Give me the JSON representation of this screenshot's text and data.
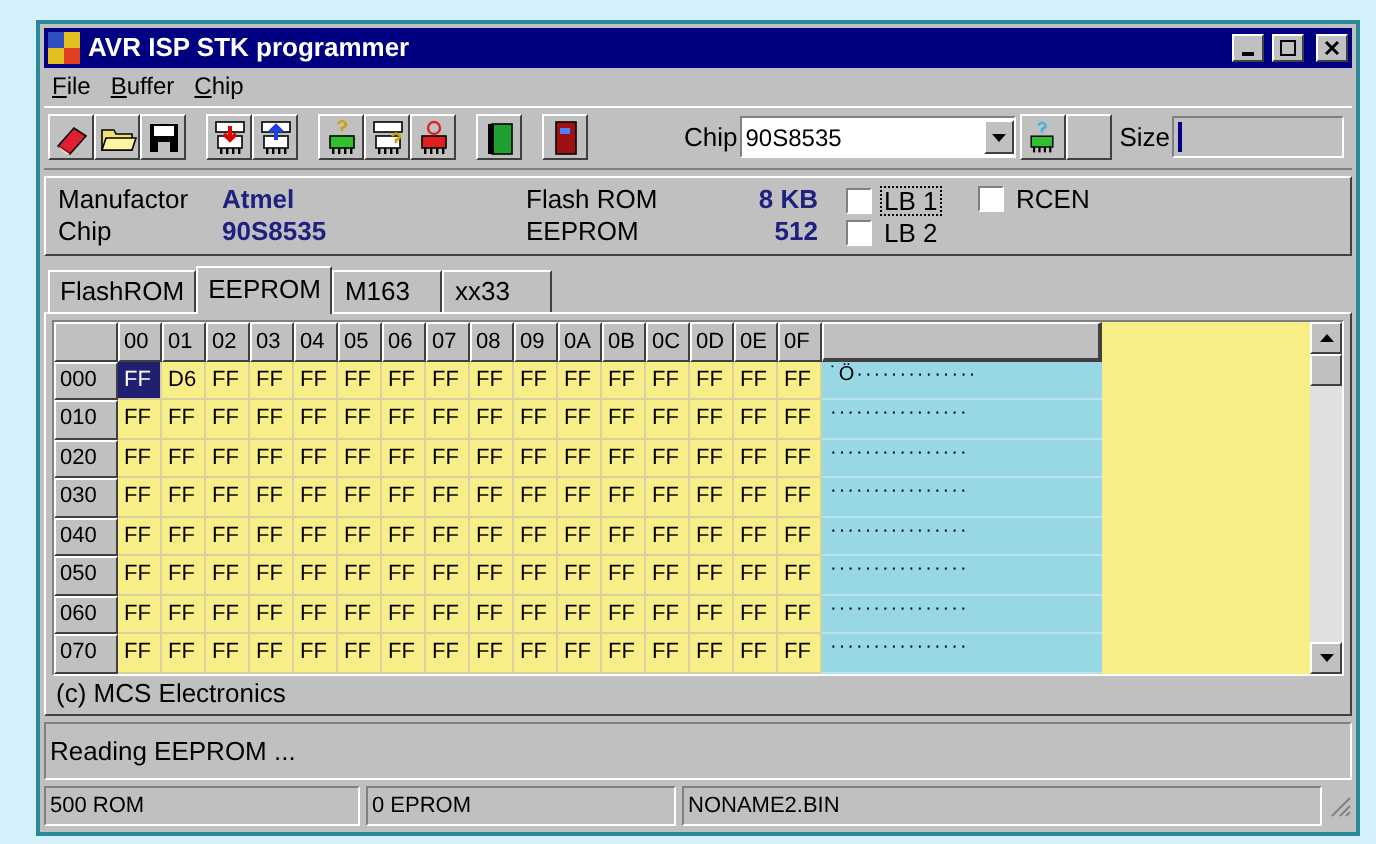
{
  "window": {
    "title": "AVR ISP STK programmer"
  },
  "menu": [
    {
      "label": "File"
    },
    {
      "label": "Buffer"
    },
    {
      "label": "Chip"
    }
  ],
  "chip_select": {
    "label": "Chip",
    "value": "90S8535"
  },
  "size": {
    "label": "Size",
    "level": 0.03
  },
  "info": {
    "manufacturer_label": "Manufactor",
    "manufacturer": "Atmel",
    "chip_label": "Chip",
    "chip": "90S8535",
    "flash_label": "Flash ROM",
    "flash": "8 KB",
    "eeprom_label": "EEPROM",
    "eeprom": "512"
  },
  "lock_bits": [
    {
      "label": "LB 1",
      "checked": false,
      "focused": true
    },
    {
      "label": "LB 2",
      "checked": false,
      "focused": false
    }
  ],
  "options": [
    {
      "label": "RCEN",
      "checked": false
    }
  ],
  "tabs": [
    {
      "label": "FlashROM",
      "selected": false
    },
    {
      "label": "EEPROM",
      "selected": true
    },
    {
      "label": "M163",
      "selected": false
    },
    {
      "label": "xx33",
      "selected": false
    }
  ],
  "grid": {
    "columns": [
      "00",
      "01",
      "02",
      "03",
      "04",
      "05",
      "06",
      "07",
      "08",
      "09",
      "0A",
      "0B",
      "0C",
      "0D",
      "0E",
      "0F"
    ],
    "rows": [
      {
        "address": "000",
        "cells": [
          {
            "text": "FF",
            "selected": true
          },
          {
            "text": "D6",
            "selected": false
          },
          {
            "text": "FF",
            "selected": false
          },
          {
            "text": "FF",
            "selected": false
          },
          {
            "text": "FF",
            "selected": false
          },
          {
            "text": "FF",
            "selected": false
          },
          {
            "text": "FF",
            "selected": false
          },
          {
            "text": "FF",
            "selected": false
          },
          {
            "text": "FF",
            "selected": false
          },
          {
            "text": "FF",
            "selected": false
          },
          {
            "text": "FF",
            "selected": false
          },
          {
            "text": "FF",
            "selected": false
          },
          {
            "text": "FF",
            "selected": false
          },
          {
            "text": "FF",
            "selected": false
          },
          {
            "text": "FF",
            "selected": false
          },
          {
            "text": "FF",
            "selected": false
          }
        ],
        "ascii": "˙Ö··············"
      },
      {
        "address": "010",
        "cells": [
          {
            "text": "FF",
            "selected": false
          },
          {
            "text": "FF",
            "selected": false
          },
          {
            "text": "FF",
            "selected": false
          },
          {
            "text": "FF",
            "selected": false
          },
          {
            "text": "FF",
            "selected": false
          },
          {
            "text": "FF",
            "selected": false
          },
          {
            "text": "FF",
            "selected": false
          },
          {
            "text": "FF",
            "selected": false
          },
          {
            "text": "FF",
            "selected": false
          },
          {
            "text": "FF",
            "selected": false
          },
          {
            "text": "FF",
            "selected": false
          },
          {
            "text": "FF",
            "selected": false
          },
          {
            "text": "FF",
            "selected": false
          },
          {
            "text": "FF",
            "selected": false
          },
          {
            "text": "FF",
            "selected": false
          },
          {
            "text": "FF",
            "selected": false
          }
        ],
        "ascii": "················"
      },
      {
        "address": "020",
        "cells": [
          {
            "text": "FF",
            "selected": false
          },
          {
            "text": "FF",
            "selected": false
          },
          {
            "text": "FF",
            "selected": false
          },
          {
            "text": "FF",
            "selected": false
          },
          {
            "text": "FF",
            "selected": false
          },
          {
            "text": "FF",
            "selected": false
          },
          {
            "text": "FF",
            "selected": false
          },
          {
            "text": "FF",
            "selected": false
          },
          {
            "text": "FF",
            "selected": false
          },
          {
            "text": "FF",
            "selected": false
          },
          {
            "text": "FF",
            "selected": false
          },
          {
            "text": "FF",
            "selected": false
          },
          {
            "text": "FF",
            "selected": false
          },
          {
            "text": "FF",
            "selected": false
          },
          {
            "text": "FF",
            "selected": false
          },
          {
            "text": "FF",
            "selected": false
          }
        ],
        "ascii": "················"
      },
      {
        "address": "030",
        "cells": [
          {
            "text": "FF",
            "selected": false
          },
          {
            "text": "FF",
            "selected": false
          },
          {
            "text": "FF",
            "selected": false
          },
          {
            "text": "FF",
            "selected": false
          },
          {
            "text": "FF",
            "selected": false
          },
          {
            "text": "FF",
            "selected": false
          },
          {
            "text": "FF",
            "selected": false
          },
          {
            "text": "FF",
            "selected": false
          },
          {
            "text": "FF",
            "selected": false
          },
          {
            "text": "FF",
            "selected": false
          },
          {
            "text": "FF",
            "selected": false
          },
          {
            "text": "FF",
            "selected": false
          },
          {
            "text": "FF",
            "selected": false
          },
          {
            "text": "FF",
            "selected": false
          },
          {
            "text": "FF",
            "selected": false
          },
          {
            "text": "FF",
            "selected": false
          }
        ],
        "ascii": "················"
      },
      {
        "address": "040",
        "cells": [
          {
            "text": "FF",
            "selected": false
          },
          {
            "text": "FF",
            "selected": false
          },
          {
            "text": "FF",
            "selected": false
          },
          {
            "text": "FF",
            "selected": false
          },
          {
            "text": "FF",
            "selected": false
          },
          {
            "text": "FF",
            "selected": false
          },
          {
            "text": "FF",
            "selected": false
          },
          {
            "text": "FF",
            "selected": false
          },
          {
            "text": "FF",
            "selected": false
          },
          {
            "text": "FF",
            "selected": false
          },
          {
            "text": "FF",
            "selected": false
          },
          {
            "text": "FF",
            "selected": false
          },
          {
            "text": "FF",
            "selected": false
          },
          {
            "text": "FF",
            "selected": false
          },
          {
            "text": "FF",
            "selected": false
          },
          {
            "text": "FF",
            "selected": false
          }
        ],
        "ascii": "················"
      },
      {
        "address": "050",
        "cells": [
          {
            "text": "FF",
            "selected": false
          },
          {
            "text": "FF",
            "selected": false
          },
          {
            "text": "FF",
            "selected": false
          },
          {
            "text": "FF",
            "selected": false
          },
          {
            "text": "FF",
            "selected": false
          },
          {
            "text": "FF",
            "selected": false
          },
          {
            "text": "FF",
            "selected": false
          },
          {
            "text": "FF",
            "selected": false
          },
          {
            "text": "FF",
            "selected": false
          },
          {
            "text": "FF",
            "selected": false
          },
          {
            "text": "FF",
            "selected": false
          },
          {
            "text": "FF",
            "selected": false
          },
          {
            "text": "FF",
            "selected": false
          },
          {
            "text": "FF",
            "selected": false
          },
          {
            "text": "FF",
            "selected": false
          },
          {
            "text": "FF",
            "selected": false
          }
        ],
        "ascii": "················"
      },
      {
        "address": "060",
        "cells": [
          {
            "text": "FF",
            "selected": false
          },
          {
            "text": "FF",
            "selected": false
          },
          {
            "text": "FF",
            "selected": false
          },
          {
            "text": "FF",
            "selected": false
          },
          {
            "text": "FF",
            "selected": false
          },
          {
            "text": "FF",
            "selected": false
          },
          {
            "text": "FF",
            "selected": false
          },
          {
            "text": "FF",
            "selected": false
          },
          {
            "text": "FF",
            "selected": false
          },
          {
            "text": "FF",
            "selected": false
          },
          {
            "text": "FF",
            "selected": false
          },
          {
            "text": "FF",
            "selected": false
          },
          {
            "text": "FF",
            "selected": false
          },
          {
            "text": "FF",
            "selected": false
          },
          {
            "text": "FF",
            "selected": false
          },
          {
            "text": "FF",
            "selected": false
          }
        ],
        "ascii": "················"
      },
      {
        "address": "070",
        "cells": [
          {
            "text": "FF",
            "selected": false
          },
          {
            "text": "FF",
            "selected": false
          },
          {
            "text": "FF",
            "selected": false
          },
          {
            "text": "FF",
            "selected": false
          },
          {
            "text": "FF",
            "selected": false
          },
          {
            "text": "FF",
            "selected": false
          },
          {
            "text": "FF",
            "selected": false
          },
          {
            "text": "FF",
            "selected": false
          },
          {
            "text": "FF",
            "selected": false
          },
          {
            "text": "FF",
            "selected": false
          },
          {
            "text": "FF",
            "selected": false
          },
          {
            "text": "FF",
            "selected": false
          },
          {
            "text": "FF",
            "selected": false
          },
          {
            "text": "FF",
            "selected": false
          },
          {
            "text": "FF",
            "selected": false
          },
          {
            "text": "FF",
            "selected": false
          }
        ],
        "ascii": "················"
      }
    ]
  },
  "copyright": "(c) MCS Electronics",
  "status_message": "Reading EEPROM ...",
  "status_bar": [
    "500 ROM",
    "0 EPROM",
    "NONAME2.BIN"
  ]
}
